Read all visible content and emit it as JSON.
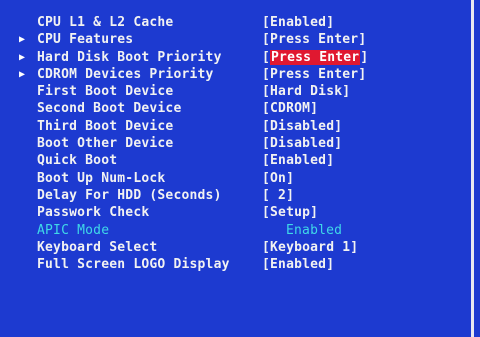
{
  "settings": [
    {
      "label": "CPU L1 & L2 Cache",
      "value_pre": "[Enabled]",
      "value_hl": "",
      "value_post": "",
      "submenu": false
    },
    {
      "label": "CPU Features",
      "value_pre": "[Press Enter]",
      "value_hl": "",
      "value_post": "",
      "submenu": true
    },
    {
      "label": "Hard Disk Boot Priority",
      "value_pre": "[",
      "value_hl": "Press Enter",
      "value_post": "]",
      "submenu": true
    },
    {
      "label": "CDROM Devices Priority",
      "value_pre": "[Press Enter]",
      "value_hl": "",
      "value_post": "",
      "submenu": true
    },
    {
      "label": "First Boot Device",
      "value_pre": "[Hard Disk]",
      "value_hl": "",
      "value_post": "",
      "submenu": false
    },
    {
      "label": "Second Boot Device",
      "value_pre": "[CDROM]",
      "value_hl": "",
      "value_post": "",
      "submenu": false
    },
    {
      "label": "Third Boot Device",
      "value_pre": "[Disabled]",
      "value_hl": "",
      "value_post": "",
      "submenu": false
    },
    {
      "label": "Boot Other Device",
      "value_pre": "[Disabled]",
      "value_hl": "",
      "value_post": "",
      "submenu": false
    },
    {
      "label": "Quick Boot",
      "value_pre": "[Enabled]",
      "value_hl": "",
      "value_post": "",
      "submenu": false
    },
    {
      "label": "Boot Up Num-Lock",
      "value_pre": "[On]",
      "value_hl": "",
      "value_post": "",
      "submenu": false
    },
    {
      "label": "Delay For HDD (Seconds)",
      "value_pre": "[ 2]",
      "value_hl": "",
      "value_post": "",
      "submenu": false
    },
    {
      "label": "Passwork Check",
      "value_pre": "[Setup]",
      "value_hl": "",
      "value_post": "",
      "submenu": false
    },
    {
      "label": "APIC Mode",
      "value_pre": "Enabled",
      "value_hl": "",
      "value_post": "",
      "submenu": false,
      "disabled": true
    },
    {
      "label": "Keyboard Select",
      "value_pre": "[Keyboard 1]",
      "value_hl": "",
      "value_post": "",
      "submenu": false
    },
    {
      "label": "Full Screen LOGO Display",
      "value_pre": "[Enabled]",
      "value_hl": "",
      "value_post": "",
      "submenu": false
    }
  ],
  "icons": {
    "submenu_arrow": "triangle-right",
    "submenu_arrow_glyph": "▶"
  },
  "colors": {
    "background": "#1d3ad0",
    "text": "#f2f2f2",
    "disabled_text": "#3fd8e8",
    "highlight": "#e01830"
  }
}
